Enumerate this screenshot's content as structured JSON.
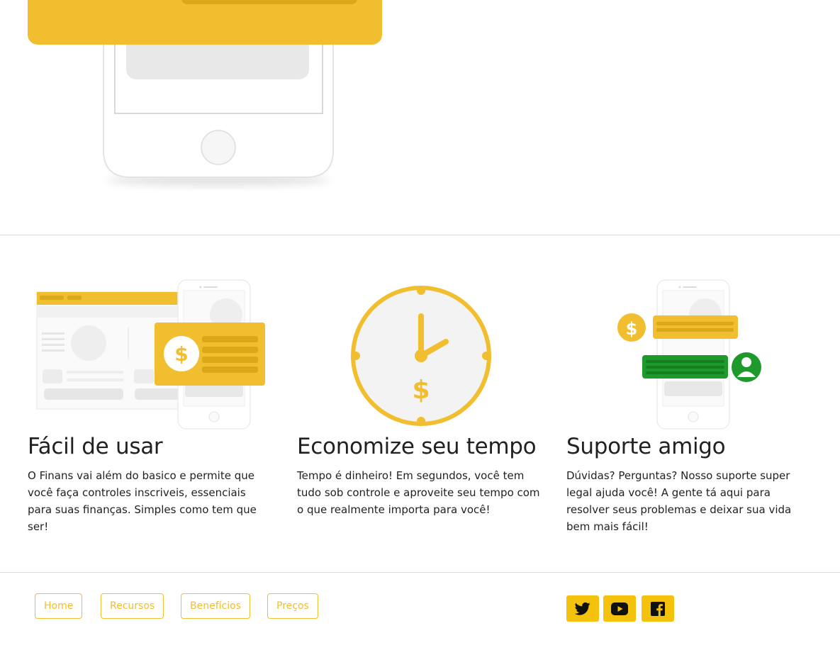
{
  "features": [
    {
      "title": "Fácil de usar",
      "text": "O Finans vai além do basico e permite que você faça controles inscriveis, essenciais para suas finanças. Simples como tem que ser!"
    },
    {
      "title": "Economize seu tempo",
      "text": "Tempo é dinheiro! Em segundos, você tem tudo sob controle e aproveite seu tempo com o que realmente importa para você!"
    },
    {
      "title": "Suporte amigo",
      "text": "Dúvidas? Perguntas? Nosso suporte super legal ajuda você! A gente tá aqui para resolver seus problemas e deixar sua vida bem mais fácil!"
    }
  ],
  "footer": {
    "nav": [
      "Home",
      "Recursos",
      "Benefícios",
      "Preços"
    ],
    "social": [
      {
        "name": "twitter",
        "icon": "twitter-icon"
      },
      {
        "name": "youtube",
        "icon": "youtube-icon"
      },
      {
        "name": "facebook",
        "icon": "facebook-icon"
      }
    ]
  },
  "colors": {
    "accent": "#f0be2e",
    "social_bg": "#f4c20d",
    "placeholder_gray": "#e8e8e8",
    "support_green": "#1e9a2c"
  }
}
